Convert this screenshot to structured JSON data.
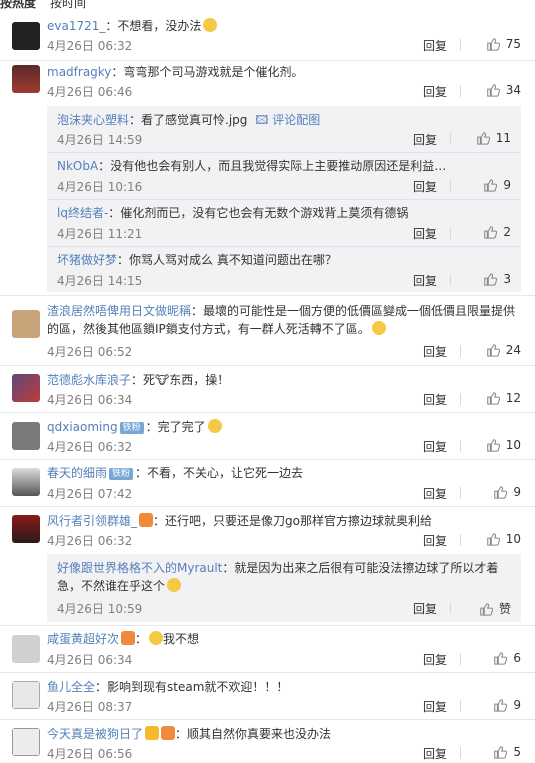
{
  "tabs": {
    "hot": "按热度",
    "time": "按时间"
  },
  "ui": {
    "reply": "回复",
    "like_word": "赞"
  },
  "comments": [
    {
      "user": "eva1721_",
      "text": "不想看，没办法",
      "time": "4月26日 06:32",
      "likes": "75"
    },
    {
      "user": "madfragky",
      "text": "弯弯那个司马游戏就是个催化剂。",
      "time": "4月26日 06:46",
      "likes": "34",
      "replies": [
        {
          "user": "泡沫夹心塑料",
          "text": "看了感觉真可怜.jpg",
          "extra": "评论配图",
          "time": "4月26日 14:59",
          "likes": "11"
        },
        {
          "user": "NkObA",
          "text": "没有他也会有别人，而且我觉得实际上主要推动原因还是利益…",
          "time": "4月26日 10:16",
          "likes": "9"
        },
        {
          "user": "lq终结者-",
          "text": "催化剂而已，没有它也会有无数个游戏背上莫须有德锅",
          "time": "4月26日 11:21",
          "likes": "2"
        },
        {
          "user": "坏猪做好梦",
          "text": "你骂人骂对成么 真不知道问题出在哪？",
          "time": "4月26日 14:15",
          "likes": "3"
        }
      ]
    },
    {
      "user": "渣浪居然唔俾用日文做昵稱",
      "text": "最壞的可能性是一個方便的低價區變成一個低價且限量提供的區，然後其他區鎖IP鎖支付方式，有一群人死活轉不了區。",
      "time": "4月26日 06:52",
      "likes": "24"
    },
    {
      "user": "范德彪水库浪子",
      "text": "死🐮东西，操！",
      "time": "4月26日 06:34",
      "likes": "12"
    },
    {
      "user": "qdxiaoming",
      "badge": "铁粉",
      "text": "完了完了",
      "time": "4月26日 06:32",
      "likes": "10"
    },
    {
      "user": "春天的细雨",
      "badge": "铁粉",
      "text": "不看，不关心，让它死一边去",
      "time": "4月26日 07:42",
      "likes": "9"
    },
    {
      "user": "风行者引领群雄_",
      "text": "还行吧，只要还是像刀go那样官方擦边球就奥利给",
      "time": "4月26日 06:32",
      "likes": "10",
      "replies": [
        {
          "user": "好像跟世界格格不入的Myrault",
          "text": "就是因为出来之后很有可能没法擦边球了所以才着急，不然谁在乎这个",
          "time": "4月26日 10:59",
          "likes": ""
        }
      ]
    },
    {
      "user": "咸蛋黄超好次",
      "text": "我不想",
      "time": "4月26日 06:34",
      "likes": "6"
    },
    {
      "user": "鱼儿全全",
      "text": "影响到现有steam就不欢迎！！！",
      "time": "4月26日 08:37",
      "likes": "9"
    },
    {
      "user": "今天真是被狗日了",
      "text": "顺其自然你真要来也没办法",
      "time": "4月26日 06:56",
      "likes": "5"
    }
  ]
}
